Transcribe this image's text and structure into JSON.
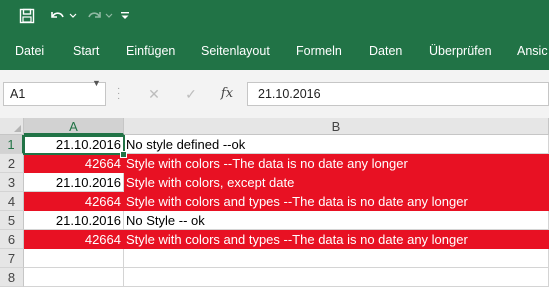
{
  "quick_access": {
    "save_icon": "save-icon",
    "undo_icon": "undo-icon",
    "redo_icon": "redo-icon",
    "customize_icon": "customize-icon"
  },
  "ribbon": {
    "tabs": [
      "Datei",
      "Start",
      "Einfügen",
      "Seitenlayout",
      "Formeln",
      "Daten",
      "Überprüfen",
      "Ansic"
    ]
  },
  "formula_bar": {
    "name_box": "A1",
    "cancel_symbol": "✕",
    "enter_symbol": "✓",
    "fx_label": "fx",
    "value": "21.10.2016"
  },
  "grid": {
    "columns": [
      "A",
      "B"
    ],
    "rows": [
      {
        "num": "1",
        "a": "21.10.2016",
        "b": "No style defined --ok",
        "style": "plain"
      },
      {
        "num": "2",
        "a": "42664",
        "b": "Style with colors --The data is no date any longer",
        "style": "red"
      },
      {
        "num": "3",
        "a": "21.10.2016",
        "b": "Style with colors, except date",
        "style": "red-b"
      },
      {
        "num": "4",
        "a": "42664",
        "b": "Style with colors and types --The data is no date any longer",
        "style": "red"
      },
      {
        "num": "5",
        "a": "21.10.2016",
        "b": "No Style -- ok",
        "style": "plain"
      },
      {
        "num": "6",
        "a": "42664",
        "b": "Style with colors and types --The data is no date any longer",
        "style": "red"
      },
      {
        "num": "7",
        "a": "",
        "b": "",
        "style": "plain"
      },
      {
        "num": "8",
        "a": "",
        "b": "",
        "style": "plain"
      }
    ],
    "fill_color": "#e81123",
    "accent_color": "#217346"
  }
}
